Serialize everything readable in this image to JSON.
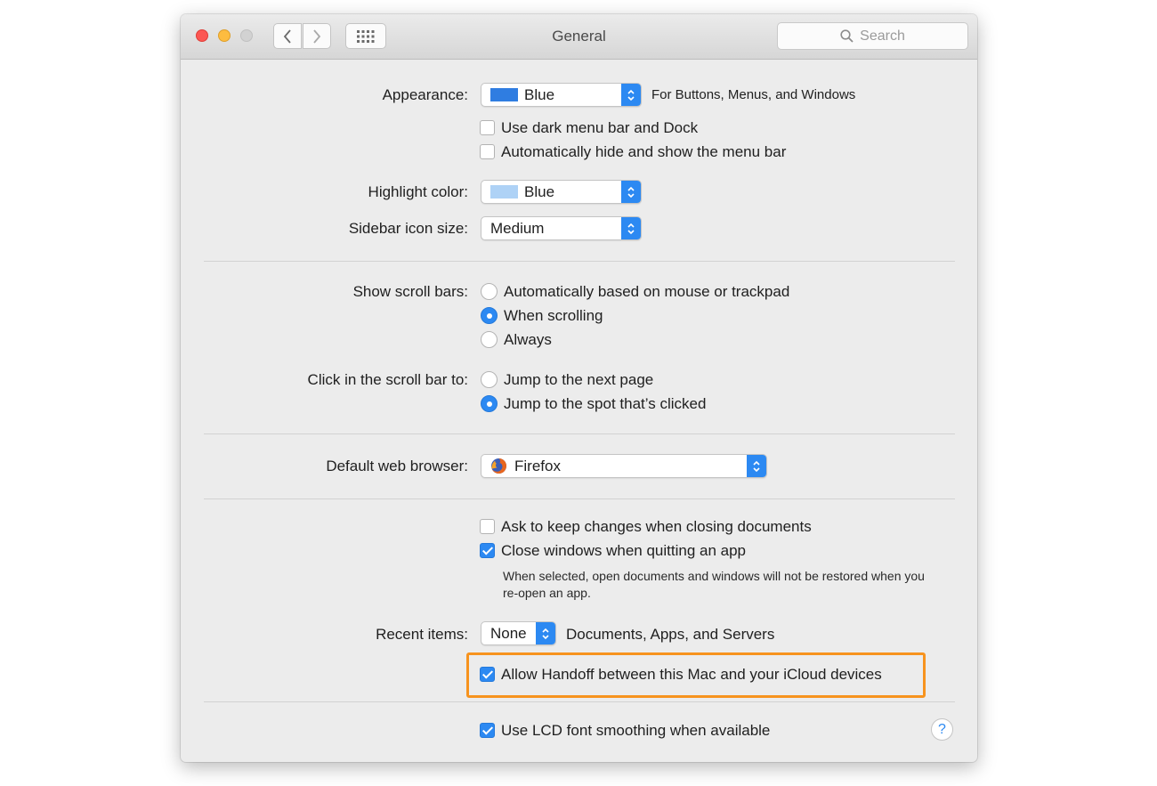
{
  "window": {
    "title": "General"
  },
  "toolbar": {
    "search_placeholder": "Search"
  },
  "appearance": {
    "label": "Appearance:",
    "value": "Blue",
    "swatch_color": "#2f7de1",
    "note": "For Buttons, Menus, and Windows",
    "dark_menu_bar": {
      "label": "Use dark menu bar and Dock",
      "checked": false
    },
    "auto_hide_menu_bar": {
      "label": "Automatically hide and show the menu bar",
      "checked": false
    }
  },
  "highlight_color": {
    "label": "Highlight color:",
    "value": "Blue",
    "swatch_color": "#aed2f6"
  },
  "sidebar_icon_size": {
    "label": "Sidebar icon size:",
    "value": "Medium"
  },
  "scroll_bars": {
    "label": "Show scroll bars:",
    "options": [
      "Automatically based on mouse or trackpad",
      "When scrolling",
      "Always"
    ],
    "selected": "When scrolling"
  },
  "click_scroll_bar": {
    "label": "Click in the scroll bar to:",
    "options": [
      "Jump to the next page",
      "Jump to the spot that’s clicked"
    ],
    "selected": "Jump to the spot that’s clicked"
  },
  "default_browser": {
    "label": "Default web browser:",
    "value": "Firefox"
  },
  "documents": {
    "ask_keep_changes": {
      "label": "Ask to keep changes when closing documents",
      "checked": false
    },
    "close_windows": {
      "label": "Close windows when quitting an app",
      "checked": true
    },
    "close_windows_note": "When selected, open documents and windows will not be restored when you re-open an app."
  },
  "recent_items": {
    "label": "Recent items:",
    "value": "None",
    "suffix": "Documents, Apps, and Servers"
  },
  "handoff": {
    "label": "Allow Handoff between this Mac and your iCloud devices",
    "checked": true,
    "highlight_color": "#f7931e"
  },
  "lcd_smoothing": {
    "label": "Use LCD font smoothing when available",
    "checked": true
  },
  "help": {
    "label": "?"
  },
  "colors": {
    "accent": "#2c89f2"
  }
}
